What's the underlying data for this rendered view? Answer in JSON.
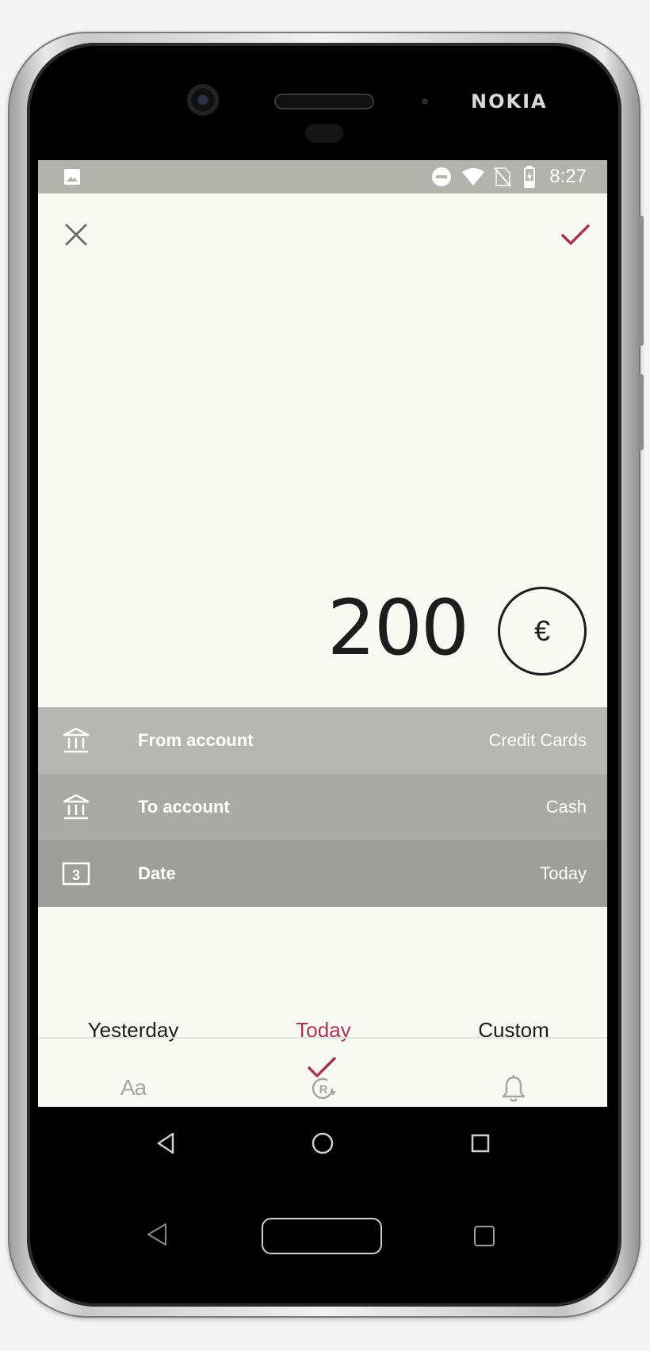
{
  "device": {
    "brand": "NOKIA"
  },
  "status_bar": {
    "time": "8:27",
    "icons": [
      "image-notification-icon",
      "do-not-disturb-icon",
      "wifi-icon",
      "no-sim-icon",
      "battery-charging-icon"
    ]
  },
  "top_bar": {
    "close_icon": "close-icon",
    "confirm_icon": "check-icon"
  },
  "amount": {
    "value": "200",
    "currency_symbol": "€"
  },
  "fields": [
    {
      "label": "From account",
      "value": "Credit Cards",
      "icon": "bank-icon",
      "bg": "#b6b7b2"
    },
    {
      "label": "To account",
      "value": "Cash",
      "icon": "bank-icon",
      "bg": "#a9aaa5"
    },
    {
      "label": "Date",
      "value": "Today",
      "icon": "calendar-icon",
      "icon_text": "3",
      "bg": "#9e9f9a"
    }
  ],
  "date_options": [
    {
      "label": "Yesterday",
      "selected": false
    },
    {
      "label": "Today",
      "selected": true
    },
    {
      "label": "Custom",
      "selected": false
    }
  ],
  "tools": [
    {
      "icon": "text-note-icon",
      "glyph": "Aa"
    },
    {
      "icon": "recurring-icon"
    },
    {
      "icon": "reminder-bell-icon"
    }
  ],
  "colors": {
    "accent": "#a6355c",
    "screen_bg": "#f9f9f4",
    "status_bar": "#b2b3ad",
    "text_dark": "#1d1d1d",
    "icon_gray": "#a6a6a6"
  },
  "nav": {
    "back": "back-icon",
    "home": "home-icon",
    "recents": "recents-icon"
  }
}
